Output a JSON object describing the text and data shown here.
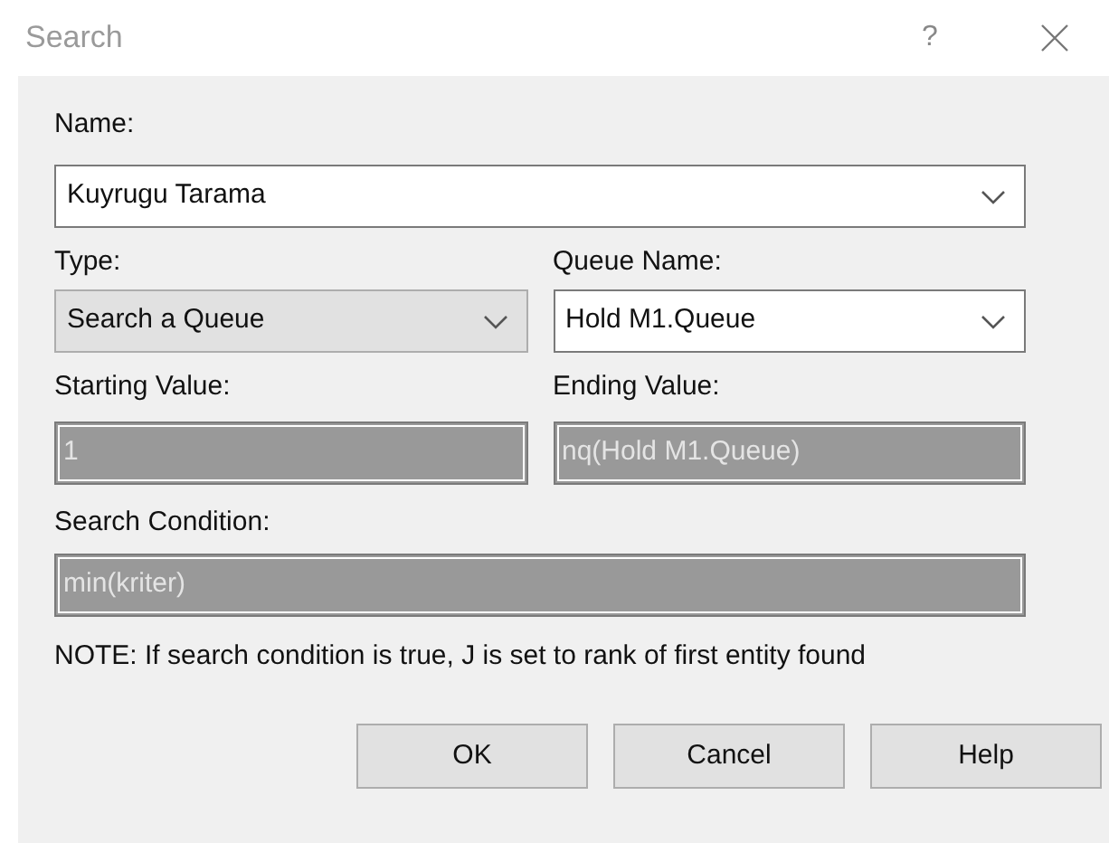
{
  "window": {
    "title": "Search",
    "help_glyph": "?"
  },
  "name": {
    "label": "Name:",
    "value": "Kuyrugu Tarama",
    "kind": "editable-combo"
  },
  "type": {
    "label": "Type:",
    "value": "Search a Queue",
    "kind": "list-combo"
  },
  "queue_name": {
    "label": "Queue Name:",
    "value": "Hold M1.Queue",
    "kind": "editable-combo"
  },
  "starting_value": {
    "label": "Starting Value:",
    "value": "1",
    "disabled": true
  },
  "ending_value": {
    "label": "Ending Value:",
    "value": "nq(Hold M1.Queue)",
    "disabled": true
  },
  "search_condition": {
    "label": "Search Condition:",
    "value": "min(kriter)",
    "disabled": true
  },
  "note": "NOTE: If search condition is true, J is set to rank of first entity found",
  "buttons": [
    "OK",
    "Cancel",
    "Help"
  ]
}
